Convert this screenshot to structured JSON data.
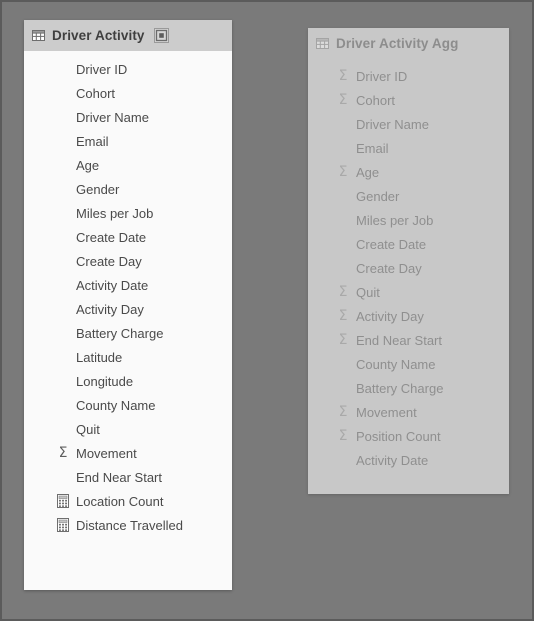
{
  "colors": {
    "canvas": "#7a7a7a",
    "canvas_border": "#5b5b5b",
    "primary_panel_bg": "#fafafa",
    "primary_header_bg": "#cccccc",
    "secondary_panel_bg": "#c8c8c8",
    "primary_text": "#4a4a4a",
    "secondary_text": "#8f8f8f"
  },
  "primary_panel": {
    "header": {
      "table_icon": "table-grid-icon",
      "title": "Driver Activity",
      "focus_icon": "focus-mode-icon"
    },
    "fields": [
      {
        "label": "Driver ID",
        "icon": "none"
      },
      {
        "label": "Cohort",
        "icon": "none"
      },
      {
        "label": "Driver Name",
        "icon": "none"
      },
      {
        "label": "Email",
        "icon": "none"
      },
      {
        "label": "Age",
        "icon": "none"
      },
      {
        "label": "Gender",
        "icon": "none"
      },
      {
        "label": "Miles per Job",
        "icon": "none"
      },
      {
        "label": "Create Date",
        "icon": "none"
      },
      {
        "label": "Create Day",
        "icon": "none"
      },
      {
        "label": "Activity Date",
        "icon": "none"
      },
      {
        "label": "Activity Day",
        "icon": "none"
      },
      {
        "label": "Battery Charge",
        "icon": "none"
      },
      {
        "label": "Latitude",
        "icon": "none"
      },
      {
        "label": "Longitude",
        "icon": "none"
      },
      {
        "label": "County Name",
        "icon": "none"
      },
      {
        "label": "Quit",
        "icon": "none"
      },
      {
        "label": "Movement",
        "icon": "sigma-icon"
      },
      {
        "label": "End Near Start",
        "icon": "none"
      },
      {
        "label": "Location Count",
        "icon": "calculator-icon"
      },
      {
        "label": "Distance Travelled",
        "icon": "calculator-icon"
      }
    ]
  },
  "secondary_panel": {
    "header": {
      "table_icon": "table-grid-icon",
      "title": "Driver Activity Agg"
    },
    "fields": [
      {
        "label": "Driver ID",
        "icon": "sigma-icon"
      },
      {
        "label": "Cohort",
        "icon": "sigma-icon"
      },
      {
        "label": "Driver Name",
        "icon": "none"
      },
      {
        "label": "Email",
        "icon": "none"
      },
      {
        "label": "Age",
        "icon": "sigma-icon"
      },
      {
        "label": "Gender",
        "icon": "none"
      },
      {
        "label": "Miles per Job",
        "icon": "none"
      },
      {
        "label": "Create Date",
        "icon": "none"
      },
      {
        "label": "Create Day",
        "icon": "none"
      },
      {
        "label": "Quit",
        "icon": "sigma-icon"
      },
      {
        "label": "Activity Day",
        "icon": "sigma-icon"
      },
      {
        "label": "End Near Start",
        "icon": "sigma-icon"
      },
      {
        "label": "County Name",
        "icon": "none"
      },
      {
        "label": "Battery Charge",
        "icon": "none"
      },
      {
        "label": "Movement",
        "icon": "sigma-icon"
      },
      {
        "label": "Position Count",
        "icon": "sigma-icon"
      },
      {
        "label": "Activity Date",
        "icon": "none"
      }
    ]
  }
}
